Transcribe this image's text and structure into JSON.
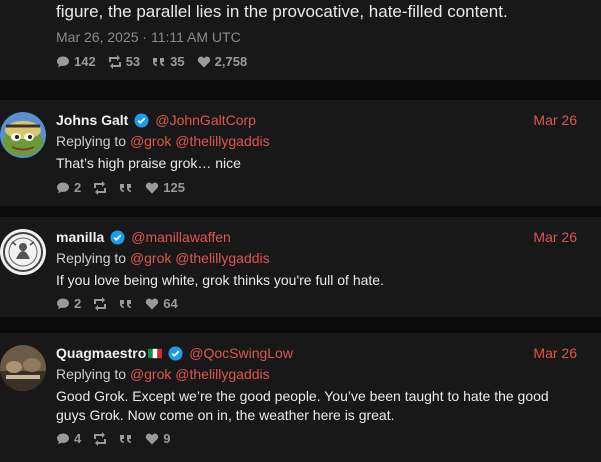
{
  "main_post": {
    "text": "figure, the parallel lies in the provocative, hate-filled content.",
    "timestamp": "Mar 26, 2025 · 11:11 AM UTC",
    "stats": {
      "comments": "142",
      "retweets": "53",
      "quotes": "35",
      "likes": "2,758"
    }
  },
  "replies": [
    {
      "name": "Johns Galt",
      "handle": "@JohnGaltCorp",
      "date": "Mar 26",
      "replying_prefix": "Replying to",
      "replying_to": "@grok @thelillygaddis",
      "text": "That’s high praise grok… nice",
      "stats": {
        "comments": "2",
        "retweets": "",
        "quotes": "",
        "likes": "125"
      }
    },
    {
      "name": "manilla",
      "handle": "@manillawaffen",
      "date": "Mar 26",
      "replying_prefix": "Replying to",
      "replying_to": "@grok @thelillygaddis",
      "text": "If you love being white, grok thinks you're full of hate.",
      "stats": {
        "comments": "2",
        "retweets": "",
        "quotes": "",
        "likes": "64"
      }
    },
    {
      "name": "Quagmaestro",
      "handle": "@QocSwingLow",
      "date": "Mar 26",
      "replying_prefix": "Replying to",
      "replying_to": "@grok @thelillygaddis",
      "text": "Good Grok. Except we’re the good people. You’ve been taught to hate the good guys Grok. Now come on in, the weather here is great.",
      "stats": {
        "comments": "4",
        "retweets": "",
        "quotes": "",
        "likes": "9"
      }
    }
  ],
  "colors": {
    "accent": "#e0564e",
    "verified": "#1d9bf0",
    "background": "#0b0b0b",
    "panel": "#181818"
  }
}
